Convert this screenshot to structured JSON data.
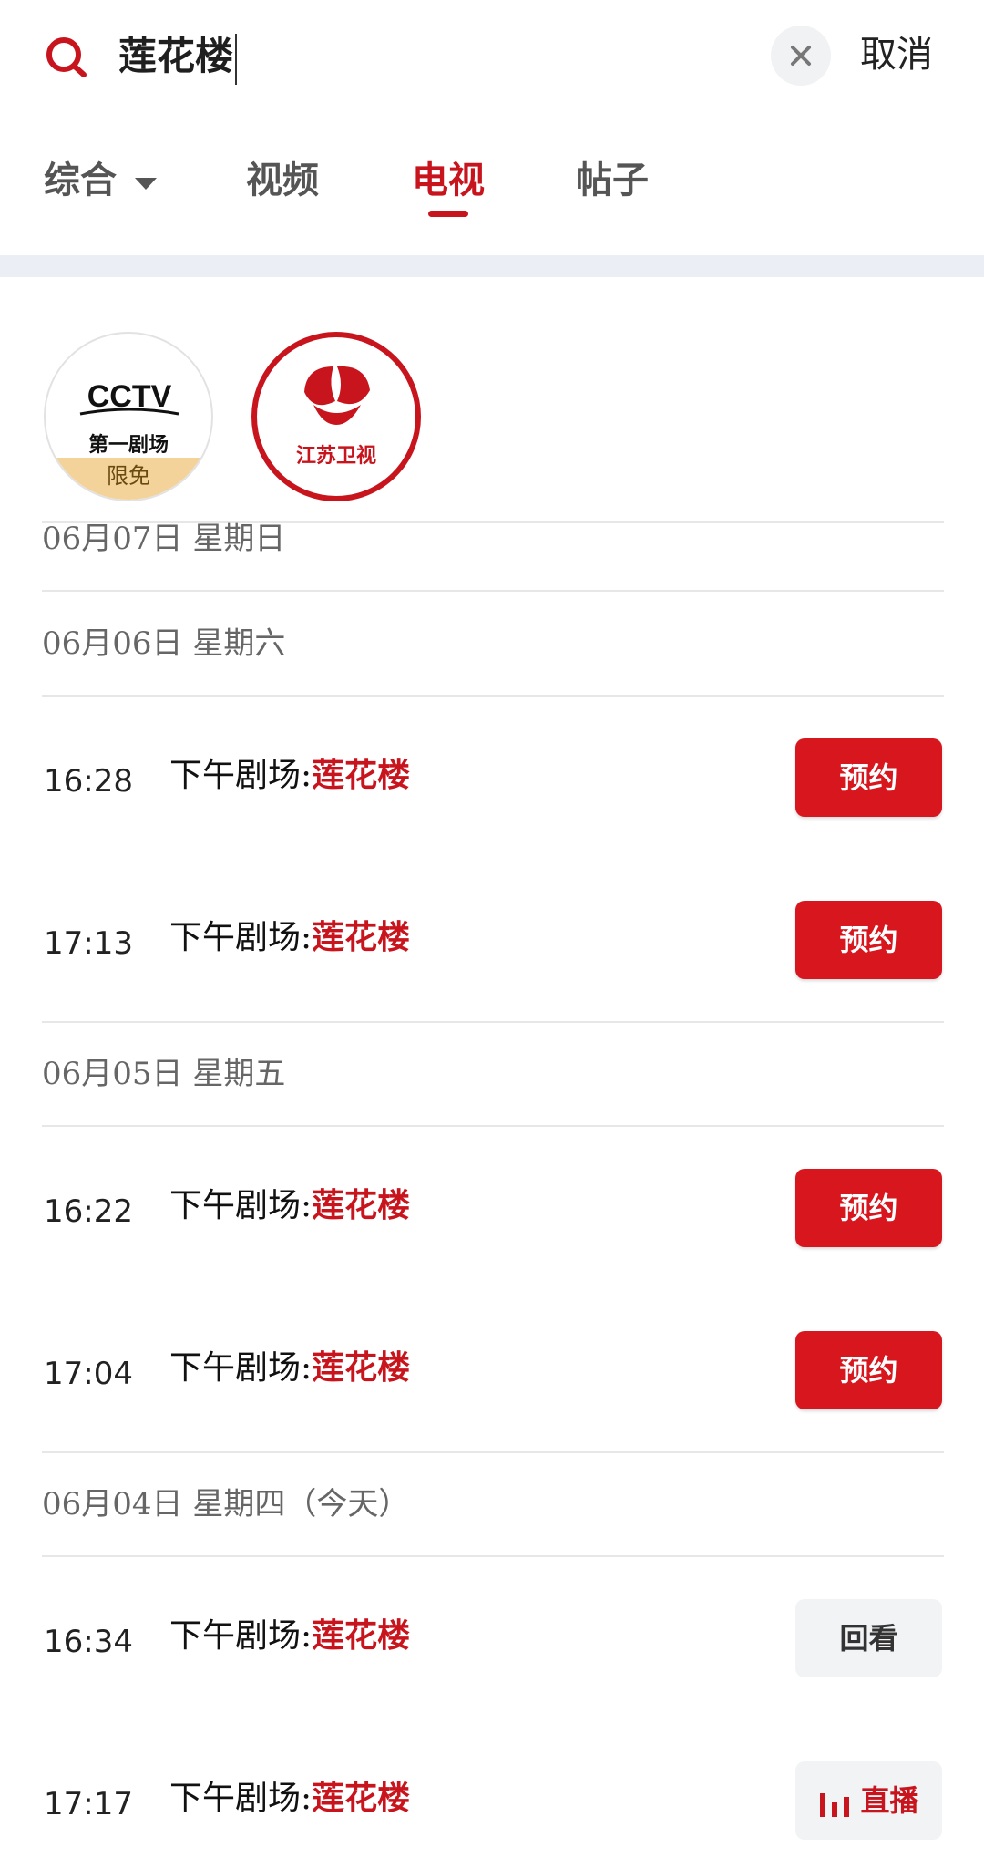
{
  "search": {
    "query": "莲花楼",
    "cancel_label": "取消"
  },
  "tabs": [
    {
      "label": "综合"
    },
    {
      "label": "视频"
    },
    {
      "label": "电视"
    },
    {
      "label": "帖子"
    }
  ],
  "active_tab": "电视",
  "channels": [
    {
      "name": "CCTV",
      "sub": "第一剧场",
      "badge": "限免"
    },
    {
      "name": "江苏卫视"
    }
  ],
  "days": [
    {
      "header": "06月07日  星期日",
      "programs": []
    },
    {
      "header": "06月06日  星期六",
      "programs": [
        {
          "time": "16:28",
          "prefix": "下午剧场:",
          "highlight": "莲花楼",
          "action": "预约"
        },
        {
          "time": "17:13",
          "prefix": "下午剧场:",
          "highlight": "莲花楼",
          "action": "预约"
        }
      ]
    },
    {
      "header": "06月05日  星期五",
      "programs": [
        {
          "time": "16:22",
          "prefix": "下午剧场:",
          "highlight": "莲花楼",
          "action": "预约"
        },
        {
          "time": "17:04",
          "prefix": "下午剧场:",
          "highlight": "莲花楼",
          "action": "预约"
        }
      ]
    },
    {
      "header": "06月04日  星期四（今天）",
      "programs": [
        {
          "time": "16:34",
          "prefix": "下午剧场:",
          "highlight": "莲花楼",
          "action": "回看"
        },
        {
          "time": "17:17",
          "prefix": "下午剧场:",
          "highlight": "莲花楼",
          "action": "直播"
        }
      ]
    }
  ],
  "colors": {
    "accent": "#c8151d",
    "button_red": "#d7161e",
    "band": "#eceef5"
  },
  "icons": {
    "search": "search-icon",
    "clear": "close-icon",
    "tab_dropdown": "caret-down-icon",
    "live": "live-bars-icon"
  }
}
